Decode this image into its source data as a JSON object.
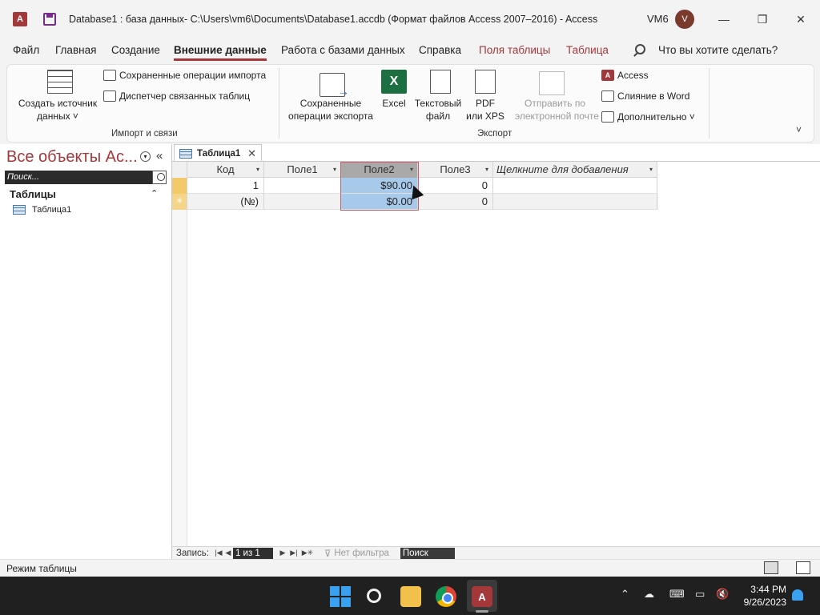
{
  "window": {
    "app_icon_letter": "A",
    "title": "Database1 : база данных- C:\\Users\\vm6\\Documents\\Database1.accdb (Формат файлов Access 2007–2016)  -  Access",
    "user_name": "VM6",
    "avatar_letter": "V",
    "minimize": "—",
    "restore": "❐",
    "close": "✕"
  },
  "menu": {
    "items": [
      "Файл",
      "Главная",
      "Создание",
      "Внешние данные",
      "Работа с базами данных",
      "Справка",
      "Поля таблицы",
      "Таблица"
    ],
    "active_index": 3,
    "search_placeholder": "Что вы хотите сделать?"
  },
  "ribbon": {
    "import_group": {
      "create_source_line1": "Создать источник",
      "create_source_line2": "данных ˅",
      "saved_imports": "Сохраненные операции импорта",
      "linked_tables_manager": "Диспетчер связанных таблиц",
      "label": "Импорт и связи"
    },
    "export_group": {
      "saved_exports_line1": "Сохраненные",
      "saved_exports_line2": "операции экспорта",
      "excel_icon": "X",
      "excel": "Excel",
      "text_file_line1": "Текстовый",
      "text_file_line2": "файл",
      "pdf_line1": "PDF",
      "pdf_line2": "или XPS",
      "email_line1": "Отправить по",
      "email_line2": "электронной почте",
      "access_icon": "A",
      "access": "Access",
      "word_merge": "Слияние в Word",
      "more": "Дополнительно ˅",
      "label": "Экспорт"
    },
    "collapse": "˅"
  },
  "nav": {
    "title": "Все объекты Ac...",
    "dropdown": "▾",
    "collapse": "«",
    "search_placeholder": "Поиск...",
    "group": "Таблицы",
    "group_toggle": "⌃",
    "items": [
      "Таблица1"
    ]
  },
  "doc": {
    "tab_label": "Таблица1",
    "tab_close": "✕",
    "columns": [
      "Код",
      "Поле1",
      "Поле2",
      "Поле3",
      "Щелкните для добавления"
    ],
    "rows": [
      [
        "1",
        "",
        "$90.00",
        "0",
        ""
      ],
      [
        "(№)",
        "",
        "$0.00",
        "0",
        ""
      ]
    ],
    "new_record_marker": "✳",
    "dropdown_glyph": "▾"
  },
  "record_nav": {
    "label": "Запись:",
    "first": "|◀",
    "prev": "◀",
    "position": "1 из 1",
    "next": "▶",
    "last": "▶|",
    "new": "▶✳",
    "filter": "Нет фильтра",
    "search": "Поиск"
  },
  "status": {
    "mode": "Режим таблицы"
  },
  "taskbar": {
    "tray_up": "⌃",
    "time": "3:44 PM",
    "date": "9/26/2023",
    "access_letter": "A"
  },
  "colors": {
    "accent": "#a4373a",
    "selection": "#a7c9ea",
    "header_selected": "#a9a9a9",
    "taskbar": "#202020"
  }
}
